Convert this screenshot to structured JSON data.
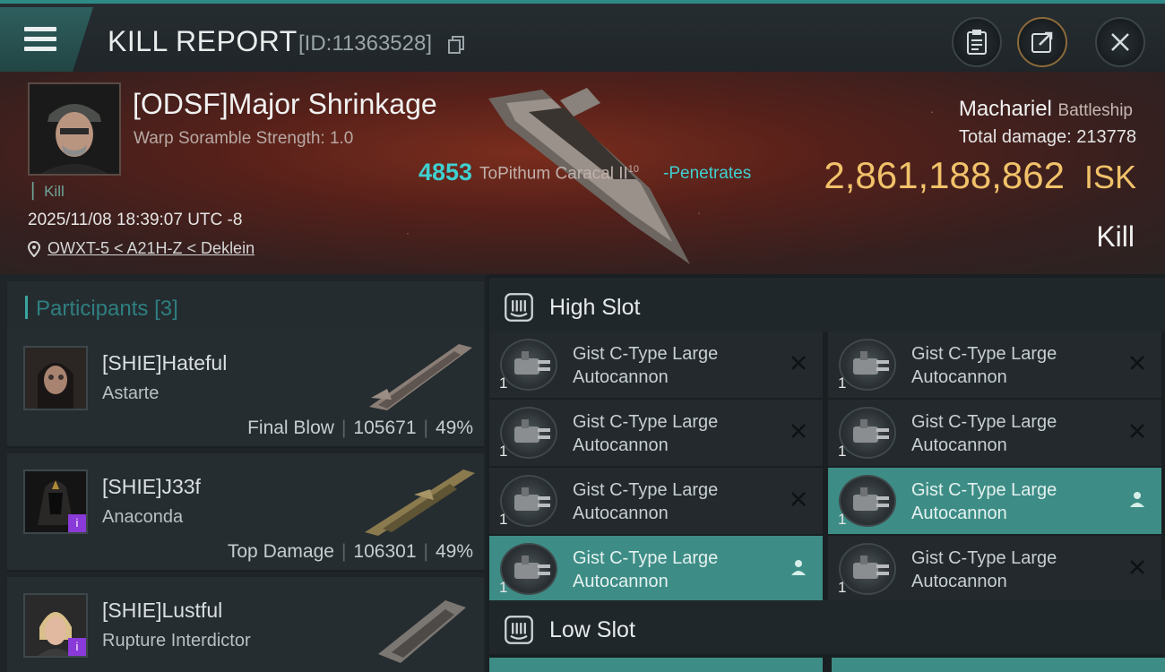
{
  "header": {
    "title": "KILL REPORT",
    "report_id": "[ID:11363528]"
  },
  "victim": {
    "name": "[ODSF]Major Shrinkage",
    "scramble": "Warp Soramble Strength: 1.0",
    "kill_tag": "Kill",
    "datetime": "2025/11/08 18:39:07 UTC -8",
    "location": "OWXT-5 < A21H-Z < Deklein",
    "ship": "Machariel",
    "ship_class": "Battleship",
    "total_damage_label": "Total damage:",
    "total_damage": "213778",
    "isk_value": "2,861,188,862",
    "isk_unit": "ISK",
    "result": "Kill"
  },
  "damage_line": {
    "amount": "4853",
    "weapon": "ToPithum Caracal II",
    "weapon_sup": "10",
    "effect": "-Penetrates"
  },
  "participants": {
    "label": "Participants",
    "count": "[3]",
    "items": [
      {
        "name": "[SHIE]Hateful",
        "ship": "Astarte",
        "role": "Final Blow",
        "damage": "105671",
        "percent": "49%"
      },
      {
        "name": "[SHIE]J33f",
        "ship": "Anaconda",
        "role": "Top Damage",
        "damage": "106301",
        "percent": "49%"
      },
      {
        "name": "[SHIE]Lustful",
        "ship": "Rupture Interdictor",
        "role": "",
        "damage": "",
        "percent": ""
      }
    ]
  },
  "slots": {
    "high_label": "High Slot",
    "low_label": "Low Slot",
    "modules": [
      {
        "line1": "Gist C-Type Large",
        "line2": "Autocannon",
        "qty": "1",
        "status": "destroyed"
      },
      {
        "line1": "Gist C-Type Large",
        "line2": "Autocannon",
        "qty": "1",
        "status": "destroyed"
      },
      {
        "line1": "Gist C-Type Large",
        "line2": "Autocannon",
        "qty": "1",
        "status": "destroyed"
      },
      {
        "line1": "Gist C-Type Large",
        "line2": "Autocannon",
        "qty": "1",
        "status": "destroyed"
      },
      {
        "line1": "Gist C-Type Large",
        "line2": "Autocannon",
        "qty": "1",
        "status": "destroyed"
      },
      {
        "line1": "Gist C-Type Large",
        "line2": "Autocannon",
        "qty": "1",
        "status": "dropped"
      },
      {
        "line1": "Gist C-Type Large",
        "line2": "Autocannon",
        "qty": "1",
        "status": "dropped"
      },
      {
        "line1": "Gist C-Type Large",
        "line2": "Autocannon",
        "qty": "1",
        "status": "destroyed"
      }
    ]
  },
  "colors": {
    "accent": "#3d8d86",
    "isk": "#f1c26a",
    "damage": "#3fd0d0",
    "badge": "#8a3ad8"
  }
}
